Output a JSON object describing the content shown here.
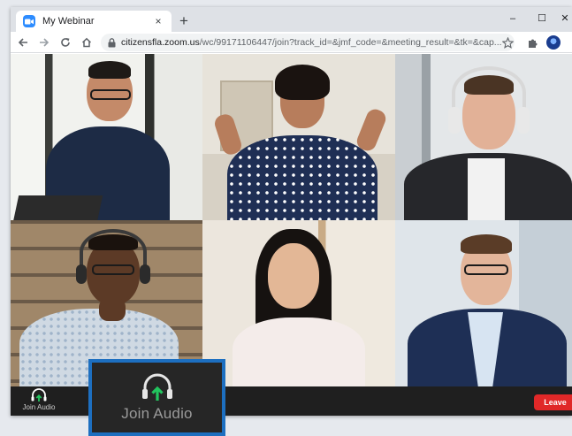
{
  "browser": {
    "tab_title": "My Webinar",
    "tab_close": "×",
    "new_tab": "+",
    "window_controls": {
      "minimize": "–",
      "maximize": "☐",
      "close": "✕"
    },
    "url_host": "citizensfla.zoom.us",
    "url_path": "/wc/99171106447/join?track_id=&jmf_code=&meeting_result=&tk=&cap..."
  },
  "icons": {
    "tab_favicon": "zoom-logo-icon",
    "back": "arrow-left-icon",
    "forward": "arrow-right-icon",
    "reload": "reload-icon",
    "home": "home-icon",
    "lock": "lock-icon",
    "bookmark": "star-icon",
    "extensions": "puzzle-icon",
    "profile": "profile-avatar-icon",
    "join_audio": "headphones-arrow-icon"
  },
  "meeting": {
    "join_audio_label": "Join Audio",
    "leave_label": "Leave",
    "callout_label": "Join Audio"
  },
  "colors": {
    "accent_blue": "#2d8cff",
    "callout_border": "#1d6fc0",
    "leave_red": "#e02828",
    "join_arrow_green": "#22c55e"
  }
}
